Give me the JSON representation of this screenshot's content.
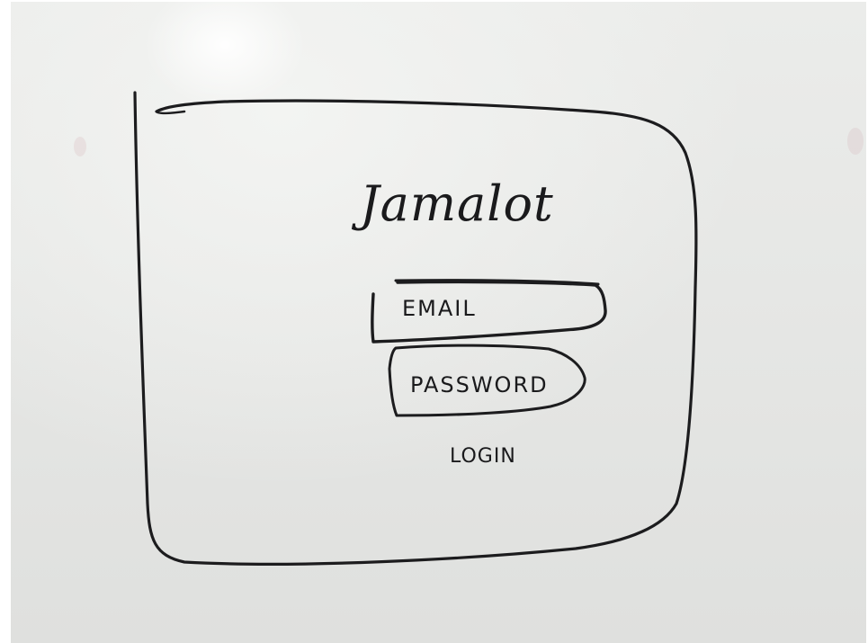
{
  "login_screen": {
    "title": "Jamalot",
    "email_placeholder": "EMAIL",
    "password_placeholder": "PASSWORD",
    "login_label": "LOGIN"
  },
  "style": {
    "ink_color": "#1c1c1e",
    "board_color": "#e6e7e5"
  }
}
